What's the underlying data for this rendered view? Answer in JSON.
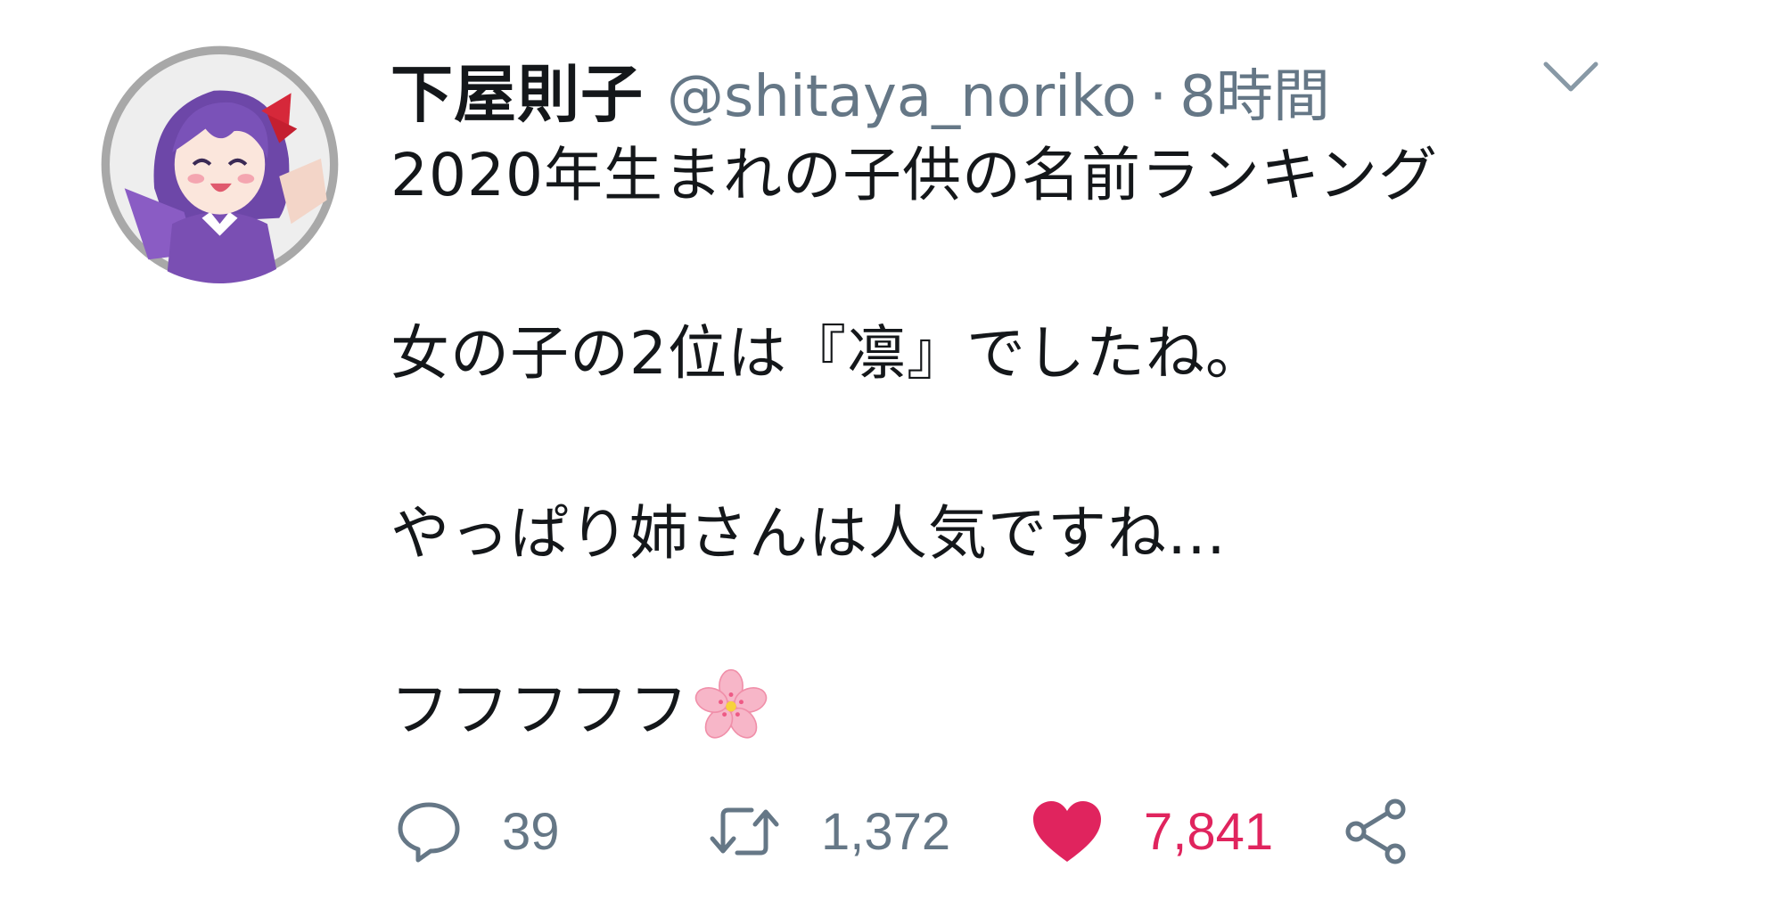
{
  "user": {
    "display_name": "下屋則子",
    "handle": "@shitaya_noriko",
    "separator": "·",
    "time": "8時間"
  },
  "tweet": {
    "lines": [
      "2020年生まれの子供の名前ランキング",
      "女の子の2位は『凛』でしたね。",
      "やっぱり姉さんは人気ですね…",
      "フフフフフ"
    ],
    "emoji": "cherry-blossom"
  },
  "actions": {
    "reply_count": "39",
    "retweet_count": "1,372",
    "like_count": "7,841",
    "liked": true
  },
  "colors": {
    "text_primary": "#14171a",
    "text_secondary": "#657786",
    "like_red": "#e0245e",
    "avatar_purple": "#7a4fb3"
  },
  "icons": {
    "reply": "reply-bubble-icon",
    "retweet": "retweet-icon",
    "like": "heart-icon",
    "share": "share-icon",
    "caret": "chevron-down-icon"
  }
}
